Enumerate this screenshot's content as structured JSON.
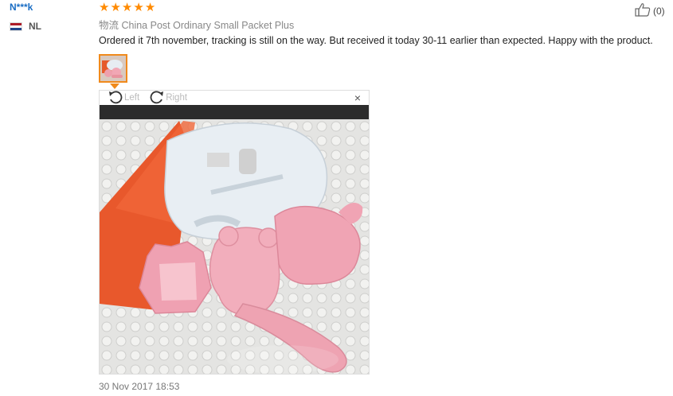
{
  "reviewer": {
    "name": "N***k",
    "country": "NL",
    "flag_colors": [
      "#ae1c28",
      "#ffffff",
      "#21468b"
    ]
  },
  "review": {
    "rating": 5,
    "rating_color": "#ff8a00",
    "logistics": "物流 China Post Ordinary Small Packet Plus",
    "text": "Ordered it 7th november, tracking is still on the way. But received it today 30-11 earlier than expected. Happy with the product.",
    "helpful_count": "(0)",
    "date": "30 Nov 2017 18:53"
  },
  "viewer": {
    "rotate_left_label": "Left",
    "rotate_right_label": "Right",
    "close_label": "×",
    "photo_description": "pink bear rice mold set"
  },
  "icons": {
    "thumb": "thumbs-up-icon",
    "rotate_left": "rotate-left-icon",
    "rotate_right": "rotate-right-icon",
    "close": "close-icon"
  }
}
